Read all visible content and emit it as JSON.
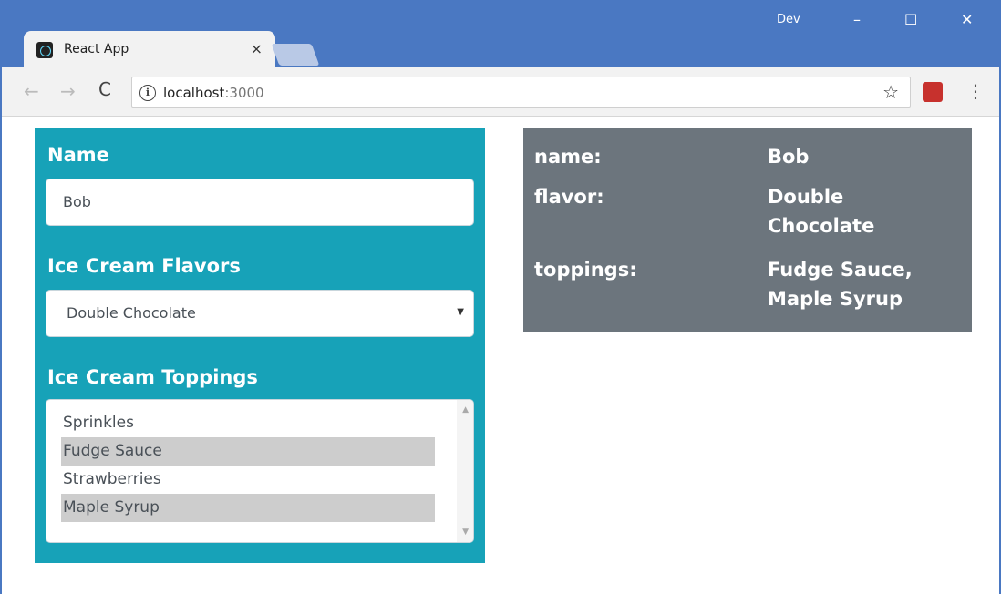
{
  "browser": {
    "tab_title": "React App",
    "tab_close": "×",
    "profile": "Dev",
    "window_controls": {
      "minimize": "–",
      "maximize": "☐",
      "close": "✕"
    },
    "url_host": "localhost",
    "url_port": ":3000",
    "icons": {
      "back": "←",
      "forward": "→",
      "reload": "C",
      "info": "i",
      "star": "☆",
      "menu": "⋮",
      "extension": "🐞"
    }
  },
  "form": {
    "name_label": "Name",
    "name_value": "Bob",
    "flavor_label": "Ice Cream Flavors",
    "flavor_value": "Double Chocolate",
    "toppings_label": "Ice Cream Toppings",
    "toppings": [
      {
        "label": "Sprinkles",
        "selected": false
      },
      {
        "label": "Fudge Sauce",
        "selected": true
      },
      {
        "label": "Strawberries",
        "selected": false
      },
      {
        "label": "Maple Syrup",
        "selected": true
      }
    ]
  },
  "summary": {
    "rows": [
      {
        "key": "name:",
        "value": "Bob"
      },
      {
        "key": "flavor:",
        "value": "Double Chocolate"
      },
      {
        "key": "toppings:",
        "value": "Fudge Sauce, Maple Syrup"
      }
    ]
  },
  "colors": {
    "titlebar": "#4a78c2",
    "form_panel": "#17a2b8",
    "summary_panel": "#6c757d",
    "selected_option": "#cdcdcd"
  }
}
